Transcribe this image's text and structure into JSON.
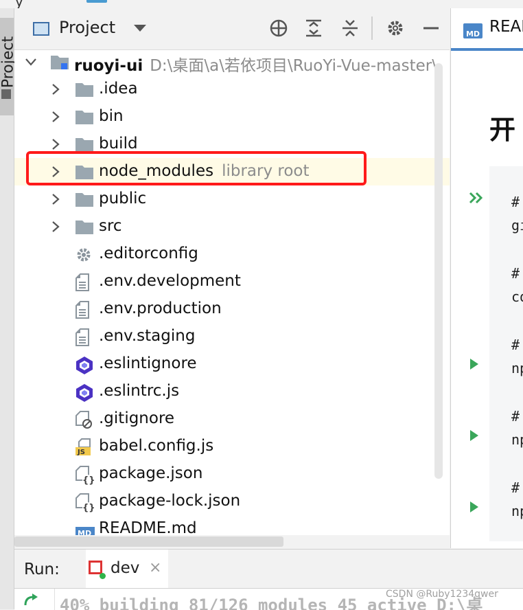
{
  "top": {
    "crumb": "y"
  },
  "sidebar_stripe": {
    "label": "Project"
  },
  "panel": {
    "title": "Project",
    "tree": {
      "root": {
        "name": "ruoyi-ui",
        "path": "D:\\桌面\\a\\若依项目\\RuoYi-Vue-master\\"
      },
      "items": [
        {
          "label": ".idea",
          "kind": "folder",
          "hint": ""
        },
        {
          "label": "bin",
          "kind": "folder",
          "hint": ""
        },
        {
          "label": "build",
          "kind": "folder",
          "hint": ""
        },
        {
          "label": "node_modules",
          "kind": "folder",
          "hint": "library root"
        },
        {
          "label": "public",
          "kind": "folder",
          "hint": ""
        },
        {
          "label": "src",
          "kind": "folder",
          "hint": ""
        },
        {
          "label": ".editorconfig",
          "kind": "settings-file",
          "hint": ""
        },
        {
          "label": ".env.development",
          "kind": "text-file",
          "hint": ""
        },
        {
          "label": ".env.production",
          "kind": "text-file",
          "hint": ""
        },
        {
          "label": ".env.staging",
          "kind": "text-file",
          "hint": ""
        },
        {
          "label": ".eslintignore",
          "kind": "eslint-file",
          "hint": ""
        },
        {
          "label": ".eslintrc.js",
          "kind": "eslint-file",
          "hint": ""
        },
        {
          "label": ".gitignore",
          "kind": "ignore-file",
          "hint": ""
        },
        {
          "label": "babel.config.js",
          "kind": "js-file",
          "hint": ""
        },
        {
          "label": "package.json",
          "kind": "json-file",
          "hint": ""
        },
        {
          "label": "package-lock.json",
          "kind": "json-file",
          "hint": ""
        },
        {
          "label": "README.md",
          "kind": "md-file",
          "hint": ""
        }
      ]
    }
  },
  "editor": {
    "tab_label": "READ",
    "md_badge": "MD",
    "heading": "开",
    "code_lines": [
      "#",
      "gi",
      "#",
      "co",
      "#",
      "np",
      "#",
      "np",
      "#",
      "np"
    ]
  },
  "run": {
    "label": "Run:",
    "tab": "dev",
    "close": "×"
  },
  "console": {
    "text": "40% building 81/126 modules 45 active D:\\桌"
  },
  "watermark": "CSDN @Ruby1234qwer"
}
